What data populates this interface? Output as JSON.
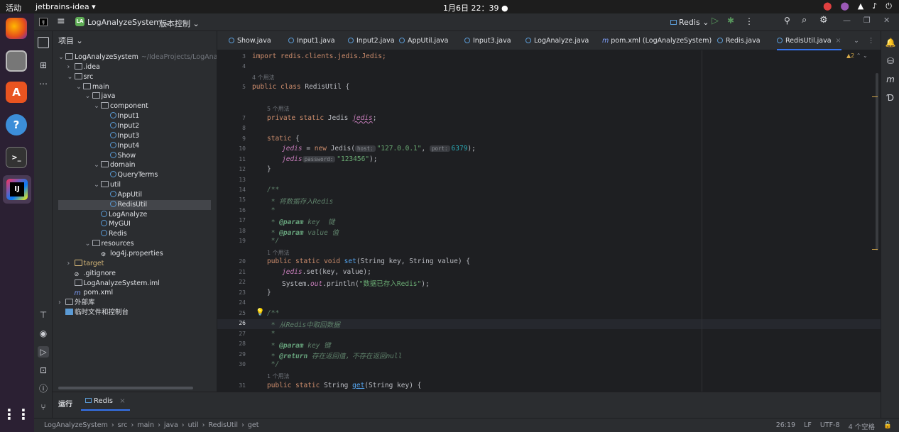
{
  "topbar": {
    "activities": "活动",
    "app": "jetbrains-idea ▾",
    "clock": "1月6日  22：39",
    "dot": "●",
    "sys": [
      "▲",
      "♪",
      "⏻"
    ]
  },
  "ide": {
    "project_badge": "LA",
    "project": "LogAnalyzeSystem",
    "vcs": "版本控制",
    "run_config": "Redis"
  },
  "project_panel": {
    "title": "项目",
    "tree": [
      {
        "arr": "⌄",
        "icon": "fold",
        "label": "LogAnalyzeSystem",
        "extra": "~/IdeaProjects/LogAnalyzeS",
        "indent": 0
      },
      {
        "arr": "›",
        "icon": "fold",
        "label": ".idea",
        "indent": 1
      },
      {
        "arr": "⌄",
        "icon": "fold",
        "label": "src",
        "indent": 1
      },
      {
        "arr": "⌄",
        "icon": "fold",
        "label": "main",
        "indent": 2
      },
      {
        "arr": "⌄",
        "icon": "fold",
        "label": "java",
        "indent": 3
      },
      {
        "arr": "⌄",
        "icon": "fold",
        "label": "component",
        "indent": 4
      },
      {
        "arr": "",
        "icon": "cls",
        "label": "Input1",
        "indent": 5
      },
      {
        "arr": "",
        "icon": "cls",
        "label": "Input2",
        "indent": 5
      },
      {
        "arr": "",
        "icon": "cls",
        "label": "Input3",
        "indent": 5
      },
      {
        "arr": "",
        "icon": "cls",
        "label": "Input4",
        "indent": 5
      },
      {
        "arr": "",
        "icon": "cls",
        "label": "Show",
        "indent": 5
      },
      {
        "arr": "⌄",
        "icon": "fold",
        "label": "domain",
        "indent": 4
      },
      {
        "arr": "",
        "icon": "cls",
        "label": "QueryTerms",
        "indent": 5
      },
      {
        "arr": "⌄",
        "icon": "fold",
        "label": "util",
        "indent": 4
      },
      {
        "arr": "",
        "icon": "cls",
        "label": "AppUtil",
        "indent": 5
      },
      {
        "arr": "",
        "icon": "cls",
        "label": "RedisUtil",
        "indent": 5
      },
      {
        "arr": "",
        "icon": "cls",
        "label": "LogAnalyze",
        "indent": 4
      },
      {
        "arr": "",
        "icon": "cls",
        "label": "MyGUI",
        "indent": 4
      },
      {
        "arr": "",
        "icon": "cls",
        "label": "Redis",
        "indent": 4
      },
      {
        "arr": "⌄",
        "icon": "fold",
        "label": "resources",
        "indent": 3
      },
      {
        "arr": "",
        "icon": "gear",
        "label": "log4j.properties",
        "indent": 4
      },
      {
        "arr": "›",
        "icon": "fold",
        "label": "target",
        "indent": 1
      },
      {
        "arr": "",
        "icon": "none",
        "label": ".gitignore",
        "indent": 1
      },
      {
        "arr": "",
        "icon": "file",
        "label": "LogAnalyzeSystem.iml",
        "indent": 1
      },
      {
        "arr": "",
        "icon": "m",
        "label": "pom.xml",
        "indent": 1
      },
      {
        "arr": "›",
        "icon": "lib",
        "label": "外部库",
        "indent": 0
      },
      {
        "arr": "",
        "icon": "scratch",
        "label": "临时文件和控制台",
        "indent": 0
      }
    ]
  },
  "tabs": [
    {
      "label": "Show.java",
      "icon": "c"
    },
    {
      "label": "Input1.java",
      "icon": "c"
    },
    {
      "label": "Input2.java",
      "icon": "c"
    },
    {
      "label": "AppUtil.java",
      "icon": "c"
    },
    {
      "label": "Input3.java",
      "icon": "c"
    },
    {
      "label": "LogAnalyze.java",
      "icon": "c"
    },
    {
      "label": "pom.xml (LogAnalyzeSystem)",
      "icon": "m"
    },
    {
      "label": "Redis.java",
      "icon": "c"
    },
    {
      "label": "RedisUtil.java",
      "icon": "c",
      "active": true
    }
  ],
  "editor": {
    "warnings": "▲2",
    "line_numbers": [
      "3",
      "4",
      "",
      "5",
      "",
      "7",
      "8",
      "9",
      "10",
      "11",
      "12",
      "13",
      "14",
      "15",
      "16",
      "17",
      "18",
      "19",
      "",
      "20",
      "21",
      "22",
      "23",
      "24",
      "25",
      "26",
      "27",
      "28",
      "29",
      "30",
      "",
      "31"
    ],
    "hints": {
      "uses4": "4 个用法",
      "uses5": "5 个用法",
      "uses1a": "1 个用法",
      "uses1b": "1 个用法"
    },
    "code": {
      "l3_a": "import redis.clients.jedis.Jedis;",
      "l5_a": "public class ",
      "l5_b": "RedisUtil {",
      "l7_a": "private static ",
      "l7_b": "Jedis ",
      "l7_c": "jedis",
      ";": ";",
      "l9_a": "static ",
      "l9_b": "{",
      "l10_a": "jedis",
      " = ": " = ",
      "l10_new": "new ",
      "l10_b": "Jedis(",
      "host": "host:",
      "l10_s": "\"127.0.0.1\"",
      ",": ", ",
      "port": "port:",
      "l10_n": "6379",
      "l10_e": ");",
      "l11_a": "jedis",
      ".auth(": ".auth(",
      "pwd": "password:",
      "l11_s": "\"123456\"",
      "l11_e": ");",
      "l12": "}",
      "l14": "/**",
      "l15": " * 将数据存入Redis",
      "l16": " *",
      "l17_a": " * ",
      "l17_tag": "@param",
      "l17_b": " key  键",
      "l18_a": " * ",
      "l18_tag": "@param",
      "l18_b": " value 值",
      "l19": " */",
      "l20_a": "public static void ",
      "l20_fn": "set",
      "l20_b": "(String key, String value) {",
      "l21_a": "jedis",
      "l21_b": ".set(key, value);",
      "l22_a": "System.",
      "l22_out": "out",
      "l22_b": ".println(",
      "l22_s": "\"数据已存入Redis\"",
      "l22_e": ");",
      "l23": "}",
      "l25": "/**",
      "l26": " * 从Redis中取回数据",
      "l27": " *",
      "l28_a": " * ",
      "l28_tag": "@param",
      "l28_b": " key 键",
      "l29_a": " * ",
      "l29_tag": "@return",
      "l29_b": " 存在返回值，不存在返回null",
      "l30": " */",
      "l31_a": "public static ",
      "l31_b": "String ",
      "l31_fn": "get",
      "l31_c": "(String key) {"
    }
  },
  "bottom": {
    "run_label": "运行",
    "tab": "Redis"
  },
  "status": {
    "crumbs": [
      "LogAnalyzeSystem",
      "src",
      "main",
      "java",
      "util",
      "RedisUtil",
      "get"
    ],
    "pos": "26:19",
    "le": "LF",
    "enc": "UTF-8",
    "indent": "4 个空格"
  },
  "colors": {
    "accent": "#3574f0",
    "bg": "#1e1f22",
    "panel": "#2b2d30"
  }
}
